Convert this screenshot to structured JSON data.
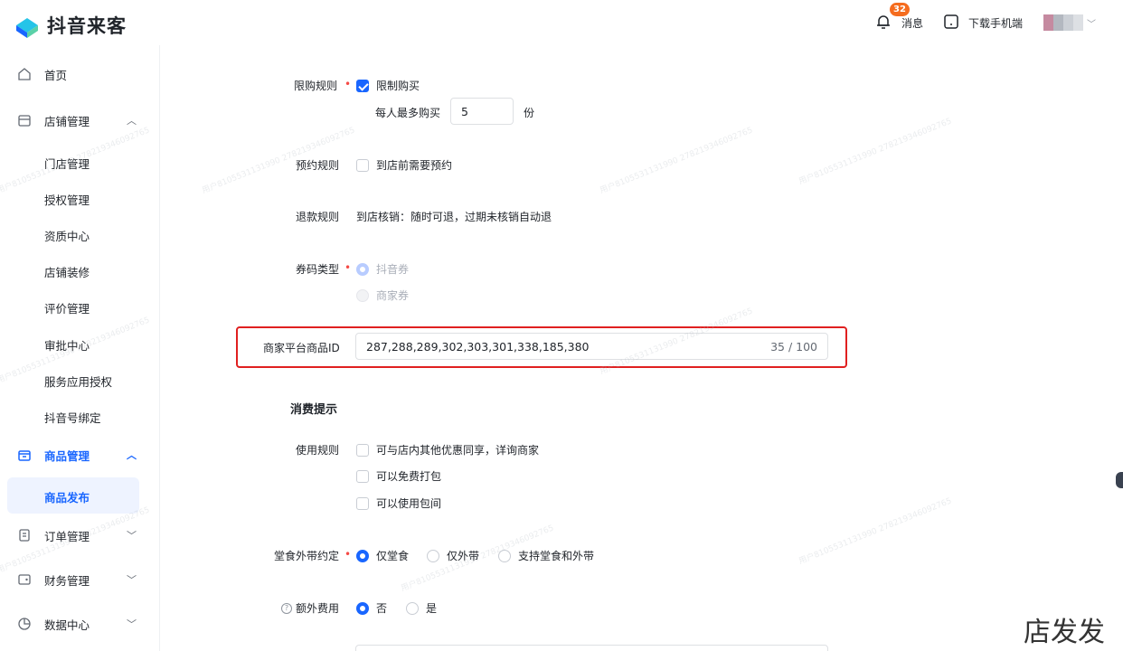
{
  "app": {
    "name": "抖音来客"
  },
  "sidebar": {
    "home": "首页",
    "store_mgmt": "店铺管理",
    "store_sub": [
      "门店管理",
      "授权管理",
      "资质中心",
      "店铺装修",
      "评价管理",
      "审批中心",
      "服务应用授权",
      "抖音号绑定"
    ],
    "product_mgmt": "商品管理",
    "product_publish": "商品发布",
    "order_mgmt": "订单管理",
    "finance_mgmt": "财务管理",
    "data_center": "数据中心"
  },
  "header": {
    "messages_label": "消息",
    "messages_count": "32",
    "download_label": "下载手机端"
  },
  "form": {
    "purchase_limit": {
      "label": "限购规则",
      "option": "限制购买",
      "checked": true,
      "per_person_label": "每人最多购买",
      "per_person_value": "5",
      "unit": "份"
    },
    "reservation": {
      "label": "预约规则",
      "option": "到店前需要预约",
      "checked": false
    },
    "refund": {
      "label": "退款规则",
      "value": "到店核销：随时可退，过期未核销自动退"
    },
    "code_type": {
      "label": "券码类型",
      "options": [
        "抖音券",
        "商家券"
      ]
    },
    "platform_id": {
      "label": "商家平台商品ID",
      "value": "287,288,289,302,303,301,338,185,380",
      "counter": "35 / 100"
    },
    "tips_title": "消费提示",
    "usage": {
      "label": "使用规则",
      "options": [
        "可与店内其他优惠同享，详询商家",
        "可以免费打包",
        "可以使用包间"
      ]
    },
    "dine": {
      "label": "堂食外带约定",
      "options": [
        "仅堂食",
        "仅外带",
        "支持堂食和外带"
      ]
    },
    "extra_fee": {
      "label": "额外费用",
      "options": [
        "否",
        "是"
      ]
    }
  },
  "watermark_text": "用户8105531131990 278219346092765",
  "corner_text": "店发发",
  "colors": {
    "primary": "#1966ff",
    "required": "#f54a45",
    "highlight": "#e02020",
    "badge": "#f56c1e"
  }
}
